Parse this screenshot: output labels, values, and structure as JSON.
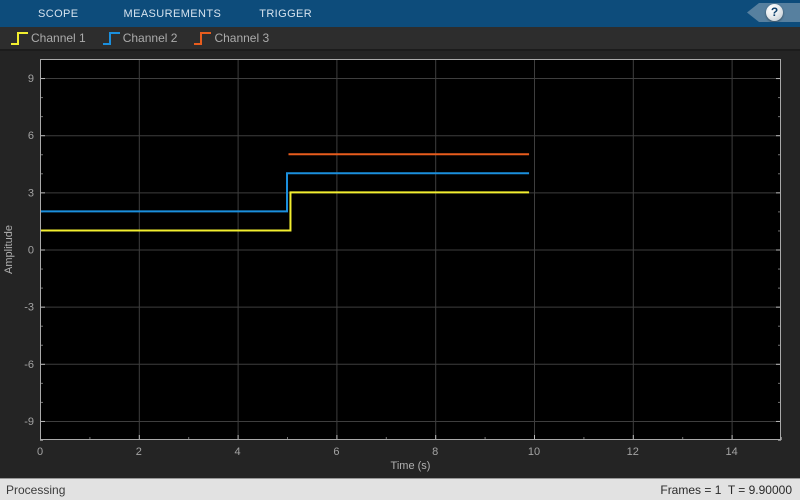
{
  "tabbar": {
    "tabs": [
      {
        "label": "SCOPE"
      },
      {
        "label": "MEASUREMENTS"
      },
      {
        "label": "TRIGGER"
      }
    ],
    "help_label": "?"
  },
  "legend": {
    "items": [
      {
        "label": "Channel 1",
        "color": "#f2ee2f"
      },
      {
        "label": "Channel 2",
        "color": "#1b8fdd"
      },
      {
        "label": "Channel 3",
        "color": "#e75c1d"
      }
    ]
  },
  "statusbar": {
    "left": "Processing",
    "right": "Frames = 1  T = 9.90000"
  },
  "chart_data": {
    "type": "line",
    "title": "",
    "xlabel": "Time (s)",
    "ylabel": "Amplitude",
    "xlim": [
      0,
      15
    ],
    "ylim": [
      -10,
      10
    ],
    "x_major_ticks": [
      0,
      2,
      4,
      6,
      8,
      10,
      12,
      14
    ],
    "y_major_ticks": [
      -9,
      -6,
      -3,
      0,
      3,
      6,
      9
    ],
    "x_minor_step": 1,
    "y_minor_step": 1,
    "grid": "major gridlines on, black background",
    "legend_position": "top-bar",
    "plot_bg": "#000000",
    "grid_color": "#3e3e3e",
    "box_color": "#a9a9a9",
    "tick_color": "#c2c2c2",
    "tick_label_color": "#a3a3a3",
    "axis_label_color": "#b0b0b0",
    "series": [
      {
        "name": "Channel 1",
        "color": "#f2ee2f",
        "points": [
          [
            0,
            1
          ],
          [
            5.07,
            1
          ],
          [
            5.07,
            3
          ],
          [
            9.9,
            3
          ]
        ]
      },
      {
        "name": "Channel 2",
        "color": "#1b8fdd",
        "points": [
          [
            0,
            2
          ],
          [
            5.0,
            2
          ],
          [
            5.0,
            4
          ],
          [
            9.9,
            4
          ]
        ]
      },
      {
        "name": "Channel 3",
        "color": "#e75c1d",
        "points": [
          [
            5.03,
            5
          ],
          [
            9.9,
            5
          ]
        ]
      }
    ]
  }
}
